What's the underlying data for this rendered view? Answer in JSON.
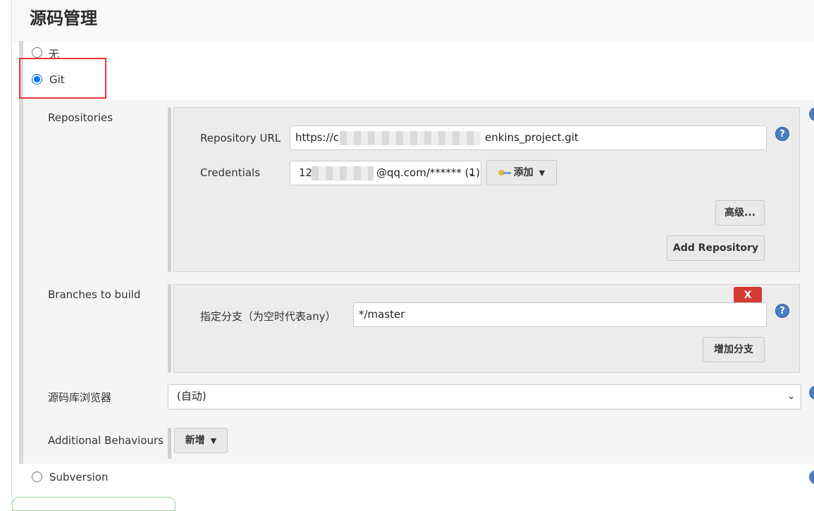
{
  "section_title": "源码管理",
  "scm_options": {
    "none_label": "无",
    "git_label": "Git",
    "subversion_label": "Subversion",
    "selected": "Git"
  },
  "git": {
    "repositories_label": "Repositories",
    "repository_url_label": "Repository URL",
    "repository_url_visible_prefix": "https://c",
    "repository_url_visible_suffix": "enkins_project.git",
    "credentials_label": "Credentials",
    "credentials_visible_prefix": "12",
    "credentials_visible_suffix": "@qq.com/****** (1)",
    "add_credentials_label": "添加",
    "advanced_label": "高级...",
    "add_repository_label": "Add Repository",
    "branches_label": "Branches to build",
    "branch_specifier_label": "指定分支（为空时代表any）",
    "branch_specifier_value": "*/master",
    "delete_branch_label": "X",
    "add_branch_label": "增加分支",
    "repo_browser_label": "源码库浏览器",
    "repo_browser_value": "(自动)",
    "additional_behaviours_label": "Additional Behaviours",
    "add_behaviour_label": "新增"
  },
  "icons": {
    "help": "help-icon",
    "key": "key-icon",
    "dropdown": "chevron-down-icon",
    "caret": "caret-down-icon"
  },
  "colors": {
    "radio_selected": "#0075ff",
    "highlight_box": "#e53935",
    "delete_button": "#d33b33",
    "help_icon": "#4a7dc3"
  }
}
